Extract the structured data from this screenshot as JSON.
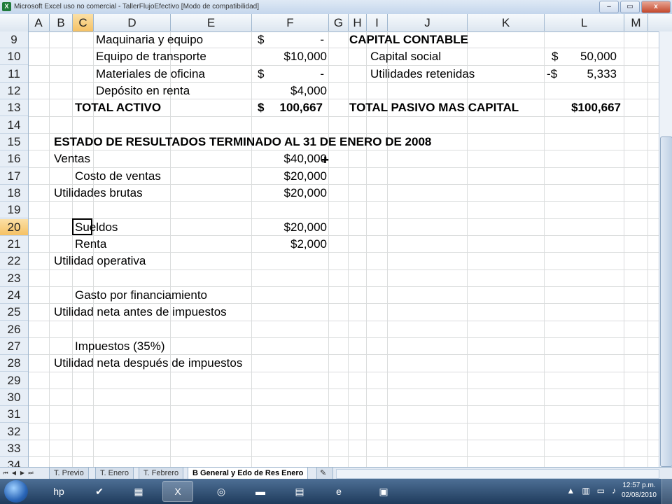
{
  "window": {
    "title": "Microsoft Excel uso no comercial - TallerFlujoEfectivo  [Modo de compatibilidad]",
    "app_icon": "X",
    "minimize": "–",
    "restore": "▭",
    "close": "x"
  },
  "columns": [
    "A",
    "B",
    "C",
    "D",
    "E",
    "F",
    "G",
    "H",
    "I",
    "J",
    "K",
    "L",
    "M"
  ],
  "selected_column": "C",
  "rows": [
    "9",
    "10",
    "11",
    "12",
    "13",
    "14",
    "15",
    "16",
    "17",
    "18",
    "19",
    "20",
    "21",
    "22",
    "23",
    "24",
    "25",
    "26",
    "27",
    "28",
    "29",
    "30",
    "31",
    "32",
    "33",
    "34"
  ],
  "selected_row": "20",
  "cells": {
    "d9": "Maquinaria y equipo",
    "f9_cur": "$",
    "f9": "-",
    "d10": "Equipo de transporte",
    "f10": "$10,000",
    "d11": "Materiales de oficina",
    "f11_cur": "$",
    "f11": "-",
    "d12": "Depósito en renta",
    "f12": "$4,000",
    "c13": "TOTAL ACTIVO",
    "f13_cur": "$",
    "f13": "100,667",
    "h9": "CAPITAL CONTABLE",
    "j10": "Capital social",
    "l10_cur": "$",
    "l10": "50,000",
    "j11": "Utilidades retenidas",
    "l11_cur": "-$",
    "l11": "5,333",
    "h13": "TOTAL PASIVO MAS CAPITAL",
    "l13": "$100,667",
    "b15": "ESTADO DE RESULTADOS TERMINADO AL 31 DE ENERO DE 2008",
    "b16": "Ventas",
    "f16": "$40,000",
    "c17": "Costo de ventas",
    "f17": "$20,000",
    "b18": "Utilidades brutas",
    "f18": "$20,000",
    "c20": "Sueldos",
    "f20": "$20,000",
    "c21": "Renta",
    "f21": "$2,000",
    "b22": "Utilidad operativa",
    "c24": "Gasto por financiamiento",
    "b25": "Utilidad neta antes de impuestos",
    "c27": "Impuestos (35%)",
    "b28": "Utilidad neta después de impuestos"
  },
  "sheet_tabs": [
    "T. Previo",
    "T. Enero",
    "T. Febrero",
    "B General y Edo de Res Enero"
  ],
  "active_tab": "B General y Edo de Res Enero",
  "taskbar": {
    "clock_time": "12:57 p.m.",
    "clock_date": "02/08/2010"
  }
}
